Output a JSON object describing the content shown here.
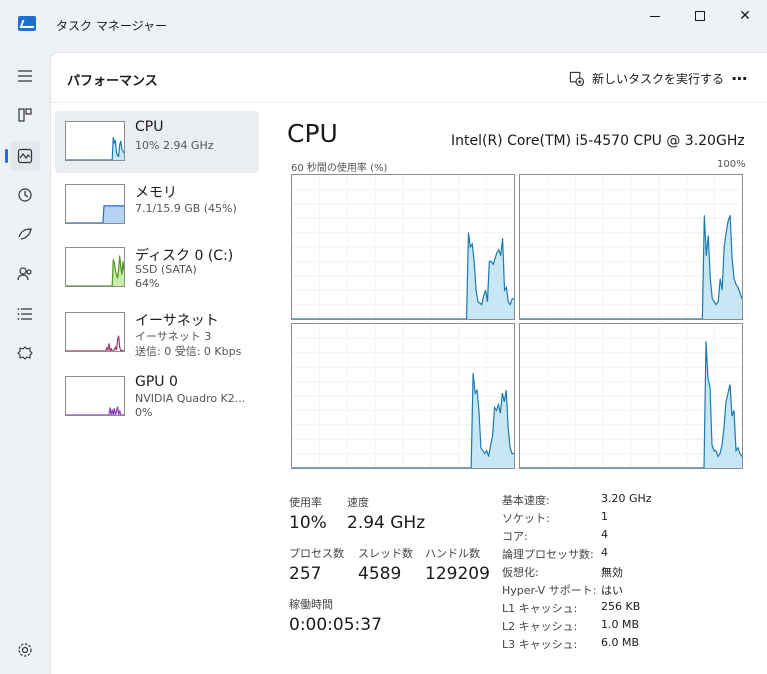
{
  "window": {
    "title": "タスク マネージャー",
    "close_glyph": "✕"
  },
  "header": {
    "title": "パフォーマンス",
    "new_task": "新しいタスクを実行する",
    "more": "⋯"
  },
  "nav": [
    "menu-icon",
    "processes-icon",
    "performance-icon",
    "app-history-icon",
    "startup-apps-icon",
    "users-icon",
    "details-icon",
    "services-icon",
    "settings-icon"
  ],
  "devices": [
    {
      "name": "CPU",
      "sub1": "10%  2.94 GHz",
      "sub2": ""
    },
    {
      "name": "メモリ",
      "sub1": "7.1/15.9 GB (45%)",
      "sub2": ""
    },
    {
      "name": "ディスク 0 (C:)",
      "sub1": "SSD (SATA)",
      "sub2": "64%"
    },
    {
      "name": "イーサネット",
      "sub1": "イーサネット 3",
      "sub2": "送信: 0 受信: 0 Kbps"
    },
    {
      "name": "GPU 0",
      "sub1": "NVIDIA Quadro K2...",
      "sub2": "0%"
    }
  ],
  "cpu": {
    "title": "CPU",
    "model": "Intel(R) Core(TM) i5-4570 CPU @ 3.20GHz",
    "usage_label": "60 秒間の使用率 (%)",
    "usage_max": "100%"
  },
  "stats": {
    "usage_label": "使用率",
    "usage": "10%",
    "speed_label": "速度",
    "speed": "2.94 GHz",
    "processes_label": "プロセス数",
    "processes": "257",
    "threads_label": "スレッド数",
    "threads": "4589",
    "handles_label": "ハンドル数",
    "handles": "129209",
    "uptime_label": "稼働時間",
    "uptime": "0:00:05:37"
  },
  "details": [
    {
      "key": "基本速度:",
      "value": "3.20 GHz"
    },
    {
      "key": "ソケット:",
      "value": "1"
    },
    {
      "key": "コア:",
      "value": "4"
    },
    {
      "key": "論理プロセッサ数:",
      "value": "4"
    },
    {
      "key": "仮想化:",
      "value": "無効"
    },
    {
      "key": "Hyper-V サポート:",
      "value": "はい"
    },
    {
      "key": "L1 キャッシュ:",
      "value": "256 KB"
    },
    {
      "key": "L2 キャッシュ:",
      "value": "1.0 MB"
    },
    {
      "key": "L3 キャッシュ:",
      "value": "6.0 MB"
    }
  ],
  "colors": {
    "accent": "#1f6fd1",
    "cpu_line": "#1b7ab0",
    "cpu_fill": "#c7e7f5",
    "memory_fill": "#b6d3f2",
    "disk_line": "#4d9a1e",
    "disk_fill": "#c9ecaa",
    "net_line": "#a3306f",
    "gpu_line": "#8e3fbf"
  },
  "graphs": [
    [
      0,
      0,
      0,
      0,
      0,
      0,
      0,
      0,
      0,
      0,
      0,
      0,
      0,
      0,
      0,
      0,
      0,
      0,
      0,
      0,
      0,
      0,
      0,
      0,
      0,
      0,
      0,
      0,
      0,
      0,
      0,
      0,
      0,
      0,
      0,
      0,
      0,
      0,
      0,
      0,
      0,
      0,
      0,
      0,
      0,
      0,
      0,
      0,
      0,
      0,
      0,
      0,
      0,
      0,
      0,
      0,
      0,
      0,
      0,
      0,
      0,
      0,
      0,
      0,
      0,
      0,
      0,
      0,
      0,
      0,
      0,
      0,
      0,
      0,
      0,
      0,
      0,
      0,
      0,
      0,
      0,
      0,
      0,
      0,
      0,
      0,
      0,
      0,
      0,
      0,
      0,
      0,
      0,
      60,
      50,
      52,
      40,
      20,
      12,
      11,
      10,
      16,
      20,
      12,
      40,
      40,
      38,
      42,
      46,
      48,
      44,
      56,
      20,
      22,
      12,
      10,
      14,
      14
    ],
    [
      0,
      0,
      0,
      0,
      0,
      0,
      0,
      0,
      0,
      0,
      0,
      0,
      0,
      0,
      0,
      0,
      0,
      0,
      0,
      0,
      0,
      0,
      0,
      0,
      0,
      0,
      0,
      0,
      0,
      0,
      0,
      0,
      0,
      0,
      0,
      0,
      0,
      0,
      0,
      0,
      0,
      0,
      0,
      0,
      0,
      0,
      0,
      0,
      0,
      0,
      0,
      0,
      0,
      0,
      0,
      0,
      0,
      0,
      0,
      0,
      0,
      0,
      0,
      0,
      0,
      0,
      0,
      0,
      0,
      0,
      0,
      0,
      0,
      0,
      0,
      0,
      0,
      0,
      0,
      0,
      0,
      0,
      0,
      0,
      0,
      0,
      0,
      0,
      0,
      0,
      0,
      0,
      0,
      72,
      44,
      58,
      28,
      14,
      12,
      10,
      12,
      28,
      20,
      50,
      60,
      68,
      72,
      42,
      28,
      24,
      22,
      18,
      14
    ],
    [
      0,
      0,
      0,
      0,
      0,
      0,
      0,
      0,
      0,
      0,
      0,
      0,
      0,
      0,
      0,
      0,
      0,
      0,
      0,
      0,
      0,
      0,
      0,
      0,
      0,
      0,
      0,
      0,
      0,
      0,
      0,
      0,
      0,
      0,
      0,
      0,
      0,
      0,
      0,
      0,
      0,
      0,
      0,
      0,
      0,
      0,
      0,
      0,
      0,
      0,
      0,
      0,
      0,
      0,
      0,
      0,
      0,
      0,
      0,
      0,
      0,
      0,
      0,
      0,
      0,
      0,
      0,
      0,
      0,
      0,
      0,
      0,
      0,
      0,
      0,
      0,
      0,
      0,
      0,
      0,
      0,
      0,
      0,
      0,
      0,
      0,
      0,
      0,
      0,
      0,
      0,
      0,
      0,
      66,
      52,
      54,
      40,
      14,
      12,
      10,
      12,
      8,
      16,
      22,
      42,
      40,
      44,
      38,
      52,
      46,
      54,
      28,
      14,
      10,
      10
    ],
    [
      0,
      0,
      0,
      0,
      0,
      0,
      0,
      0,
      0,
      0,
      0,
      0,
      0,
      0,
      0,
      0,
      0,
      0,
      0,
      0,
      0,
      0,
      0,
      0,
      0,
      0,
      0,
      0,
      0,
      0,
      0,
      0,
      0,
      0,
      0,
      0,
      0,
      0,
      0,
      0,
      0,
      0,
      0,
      0,
      0,
      0,
      0,
      0,
      0,
      0,
      0,
      0,
      0,
      0,
      0,
      0,
      0,
      0,
      0,
      0,
      0,
      0,
      0,
      0,
      0,
      0,
      0,
      0,
      0,
      0,
      0,
      0,
      0,
      0,
      0,
      0,
      0,
      0,
      0,
      0,
      0,
      0,
      0,
      0,
      0,
      0,
      0,
      0,
      0,
      0,
      0,
      0,
      0,
      88,
      62,
      56,
      16,
      12,
      12,
      8,
      10,
      16,
      28,
      46,
      52,
      58,
      36,
      40,
      12,
      14,
      10,
      8
    ]
  ],
  "thumbs": {
    "cpu": [
      0,
      0,
      0,
      0,
      0,
      0,
      0,
      0,
      0,
      0,
      0,
      0,
      0,
      0,
      0,
      0,
      0,
      0,
      0,
      0,
      0,
      0,
      0,
      0,
      0,
      0,
      0,
      0,
      0,
      0,
      0,
      0,
      0,
      0,
      0,
      0,
      0,
      0,
      0,
      0,
      0,
      0,
      0,
      0,
      60,
      45,
      50,
      20,
      12,
      10,
      40,
      50,
      28,
      24,
      18
    ],
    "memory": [
      0,
      0,
      0,
      0,
      0,
      0,
      0,
      0,
      0,
      0,
      0,
      0,
      0,
      0,
      0,
      0,
      0,
      0,
      0,
      0,
      0,
      0,
      0,
      0,
      0,
      0,
      0,
      0,
      0,
      0,
      0,
      0,
      0,
      0,
      0,
      0,
      45,
      45,
      45,
      45,
      45,
      45,
      45,
      45,
      45,
      45,
      45,
      45,
      45,
      45,
      45,
      45,
      45,
      45,
      45,
      45
    ],
    "disk": [
      0,
      0,
      0,
      0,
      0,
      0,
      0,
      0,
      0,
      0,
      0,
      0,
      0,
      0,
      0,
      0,
      0,
      0,
      0,
      0,
      0,
      0,
      0,
      0,
      0,
      0,
      0,
      0,
      0,
      0,
      0,
      0,
      0,
      0,
      0,
      0,
      0,
      0,
      0,
      0,
      0,
      0,
      0,
      0,
      70,
      60,
      40,
      30,
      20,
      45,
      80,
      50,
      30,
      65,
      40
    ],
    "net": [
      0,
      0,
      0,
      0,
      0,
      0,
      0,
      0,
      0,
      0,
      0,
      0,
      0,
      0,
      0,
      0,
      0,
      0,
      0,
      0,
      0,
      0,
      0,
      0,
      0,
      0,
      0,
      0,
      0,
      0,
      0,
      0,
      0,
      0,
      0,
      0,
      0,
      0,
      8,
      2,
      20,
      0,
      6,
      0,
      0,
      4,
      10,
      2,
      30,
      40,
      10,
      0,
      2,
      0,
      0
    ],
    "gpu": [
      0,
      0,
      0,
      0,
      0,
      0,
      0,
      0,
      0,
      0,
      0,
      0,
      0,
      0,
      0,
      0,
      0,
      0,
      0,
      0,
      0,
      0,
      0,
      0,
      0,
      0,
      0,
      0,
      0,
      0,
      0,
      0,
      0,
      0,
      0,
      0,
      0,
      0,
      0,
      0,
      0,
      20,
      0,
      14,
      0,
      18,
      0,
      10,
      22,
      0,
      12,
      0,
      0,
      0,
      0
    ]
  }
}
